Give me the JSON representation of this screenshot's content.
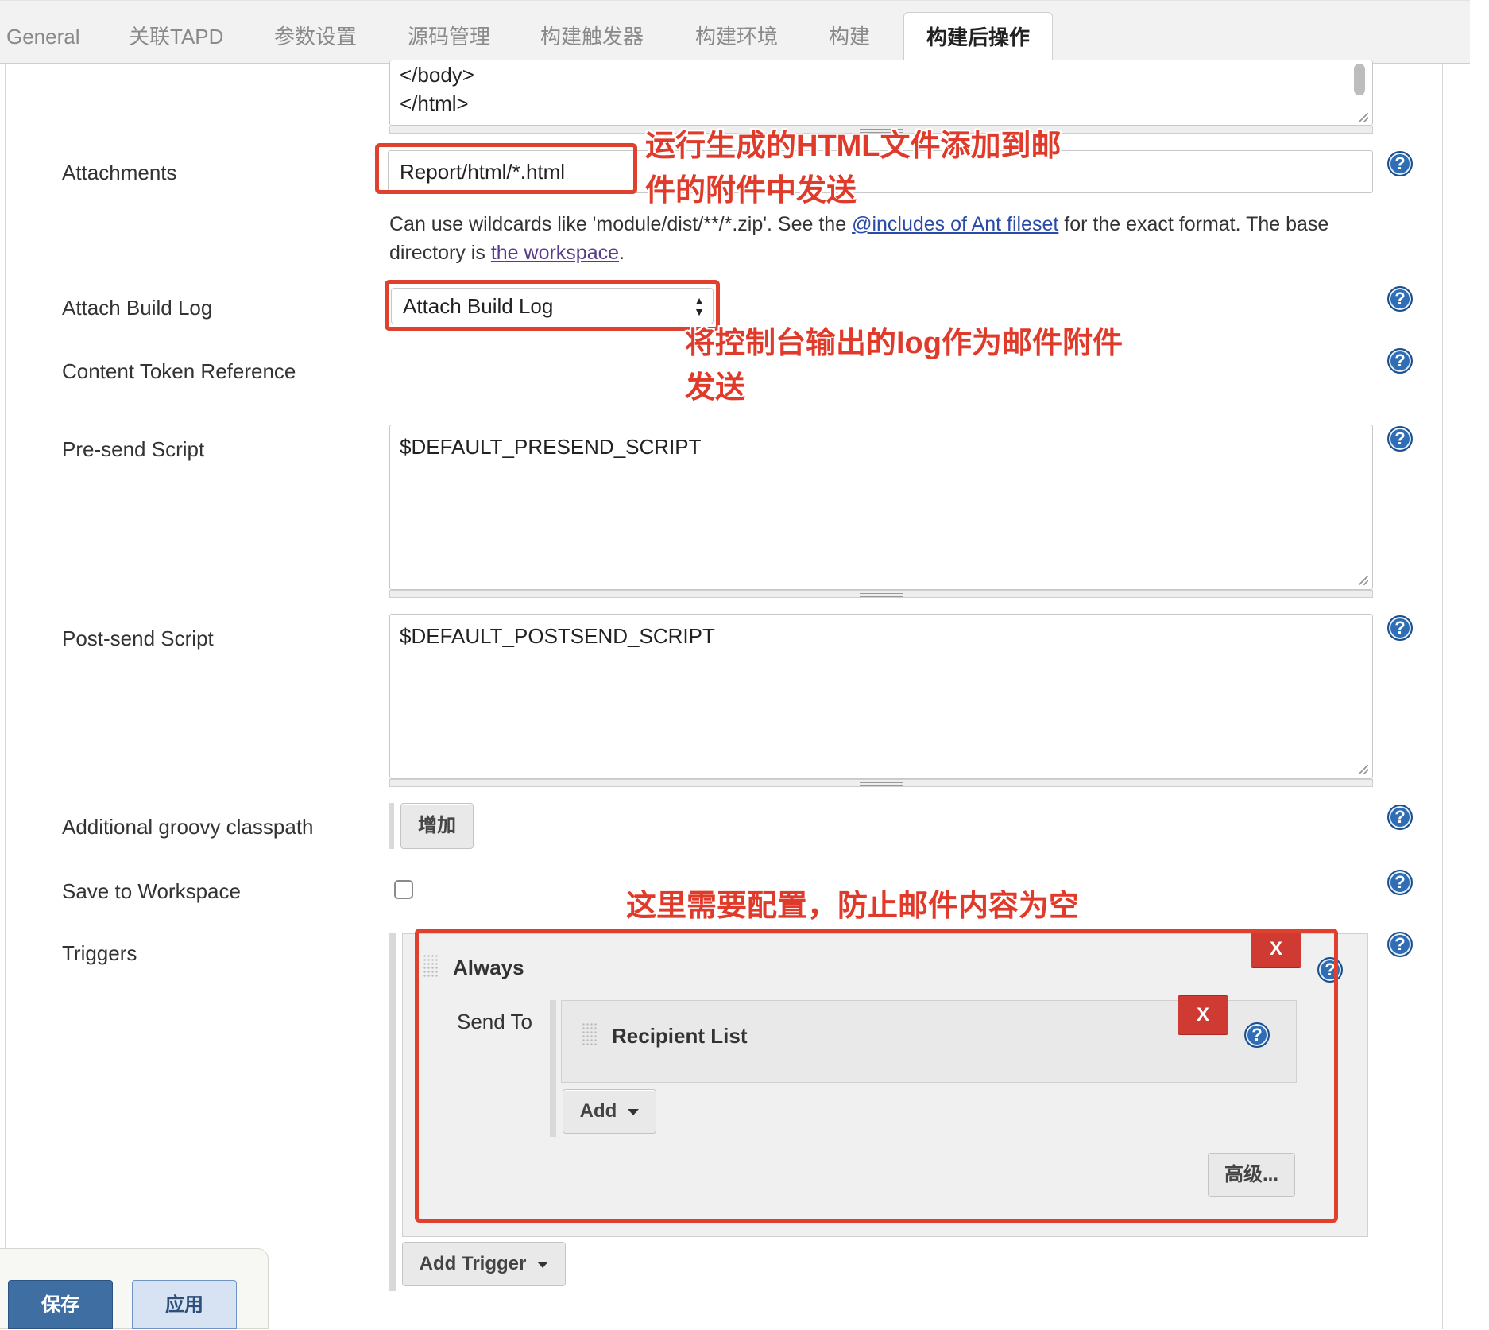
{
  "tabs": [
    "General",
    "关联TAPD",
    "参数设置",
    "源码管理",
    "构建触发器",
    "构建环境",
    "构建",
    "构建后操作"
  ],
  "active_tab": "构建后操作",
  "content_tail": {
    "line1": "</body>",
    "line2": "</html>"
  },
  "fields": {
    "attachments": {
      "label": "Attachments",
      "value": "Report/html/*.html"
    },
    "attachments_help": {
      "text1": "Can use wildcards like 'module/dist/**/*.zip'. See the ",
      "link1": "@includes of Ant fileset",
      "text2": " for the exact format. The base",
      "text3": "directory is ",
      "link2": "the workspace",
      "text4": "."
    },
    "attach_build_log": {
      "label": "Attach Build Log",
      "value": "Attach Build Log"
    },
    "content_token": {
      "label": "Content Token Reference"
    },
    "pre_send": {
      "label": "Pre-send Script",
      "value": "$DEFAULT_PRESEND_SCRIPT"
    },
    "post_send": {
      "label": "Post-send Script",
      "value": "$DEFAULT_POSTSEND_SCRIPT"
    },
    "groovy": {
      "label": "Additional groovy classpath",
      "button": "增加"
    },
    "save_workspace": {
      "label": "Save to Workspace",
      "checked": false
    },
    "triggers": {
      "label": "Triggers"
    }
  },
  "trigger": {
    "name": "Always",
    "remove": "X",
    "send_to_label": "Send To",
    "recipient": {
      "name": "Recipient List",
      "remove": "X"
    },
    "add_button": "Add",
    "advanced_button": "高级..."
  },
  "add_trigger_button": "Add Trigger",
  "bottom": {
    "save": "保存",
    "apply": "应用"
  },
  "help_icon": "help-circle-icon",
  "annotations": {
    "note1_line1": "运行生成的HTML文件添加到邮",
    "note1_line2": "件的附件中发送",
    "note2_line1": "将控制台输出的log作为邮件附件",
    "note2_line2": "发送",
    "note3": "这里需要配置，防止邮件内容为空"
  },
  "colors": {
    "annotation": "#e0412f",
    "remove_button": "#cf3a33",
    "save_button": "#3f6ea2",
    "link": "#2a4aa8"
  }
}
